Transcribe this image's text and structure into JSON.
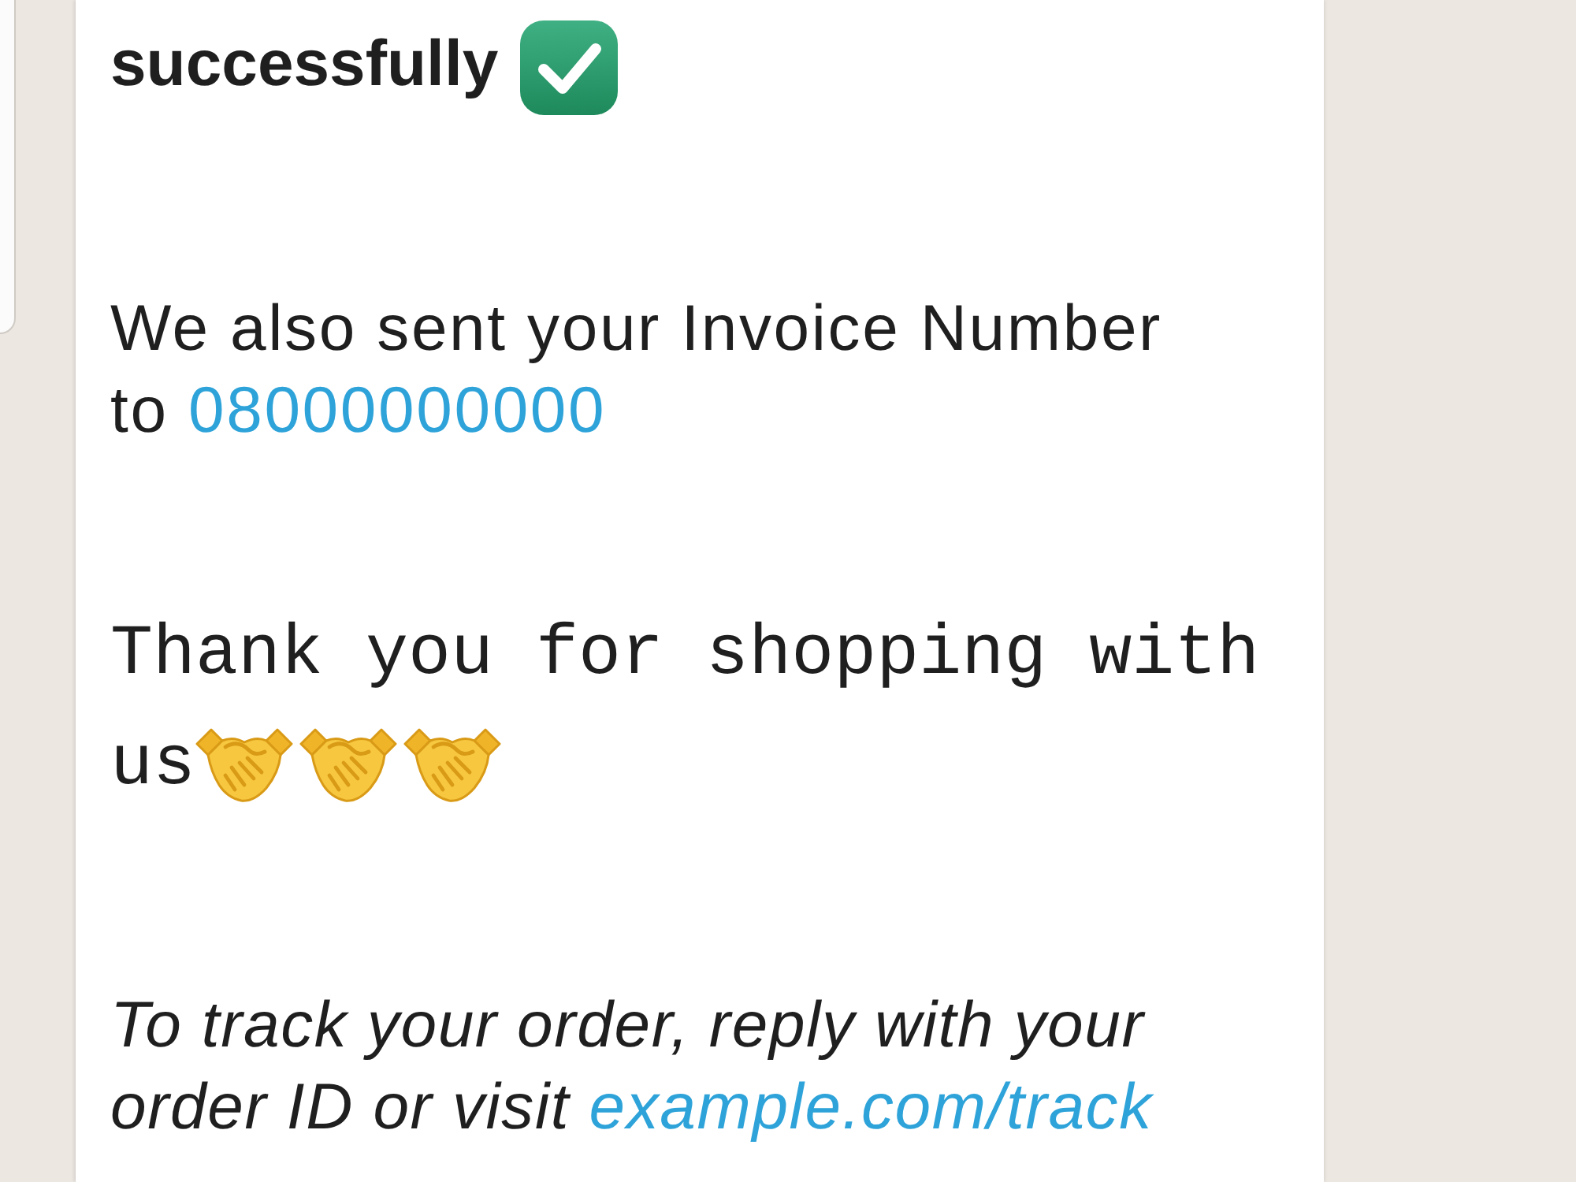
{
  "message": {
    "paragraphs": [
      {
        "kind": "bold",
        "segments": [
          {
            "kind": "text",
            "text": "successfully"
          },
          {
            "kind": "check"
          }
        ]
      },
      {
        "kind": "plain",
        "segments": [
          {
            "kind": "text",
            "text": "We also sent your Invoice Number to "
          },
          {
            "kind": "link",
            "text": "08000000000"
          }
        ]
      },
      {
        "kind": "mono",
        "segments": [
          {
            "kind": "text",
            "text": "Thank you for shopping with us"
          },
          {
            "kind": "handshake"
          },
          {
            "kind": "handshake"
          },
          {
            "kind": "handshake"
          }
        ]
      },
      {
        "kind": "italic",
        "segments": [
          {
            "kind": "text",
            "text": "To track your order, reply with your order ID or visit "
          },
          {
            "kind": "link",
            "text": "example.com/track"
          }
        ]
      }
    ]
  }
}
